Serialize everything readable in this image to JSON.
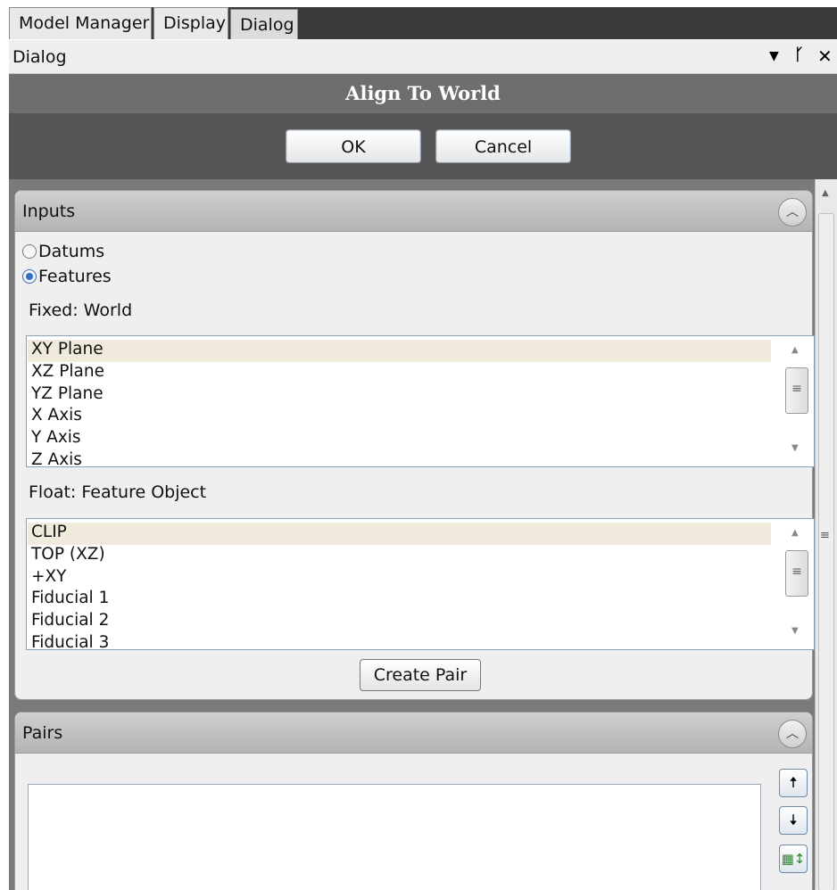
{
  "tabs": [
    {
      "label": "Model Manager"
    },
    {
      "label": "Display"
    },
    {
      "label": "Dialog"
    }
  ],
  "panel_title": "Dialog",
  "title_icons": {
    "dropdown": "chevron-down-icon",
    "pin": "pin-icon",
    "close": "close-icon"
  },
  "dialog": {
    "title": "Align To World",
    "ok_label": "OK",
    "cancel_label": "Cancel"
  },
  "inputs": {
    "header": "Inputs",
    "radio_datums": "Datums",
    "radio_features": "Features",
    "selected_radio": "Features",
    "fixed_label": "Fixed: World",
    "fixed_items": [
      "XY Plane",
      "XZ Plane",
      "YZ Plane",
      "X Axis",
      "Y Axis",
      "Z Axis"
    ],
    "float_label": "Float: Feature Object",
    "float_items": [
      "CLIP",
      "TOP (XZ)",
      "+XY",
      "Fiducial 1",
      "Fiducial 2",
      "Fiducial 3"
    ],
    "create_pair_label": "Create Pair"
  },
  "pairs": {
    "header": "Pairs",
    "buttons": [
      "move-up-icon",
      "move-down-icon",
      "swap-icon"
    ]
  },
  "colors": {
    "header_bg": "#6e6e6e",
    "content_bg": "#7a7a7a",
    "selected_row": "#efeadc",
    "radio_accent": "#2e73c8"
  }
}
